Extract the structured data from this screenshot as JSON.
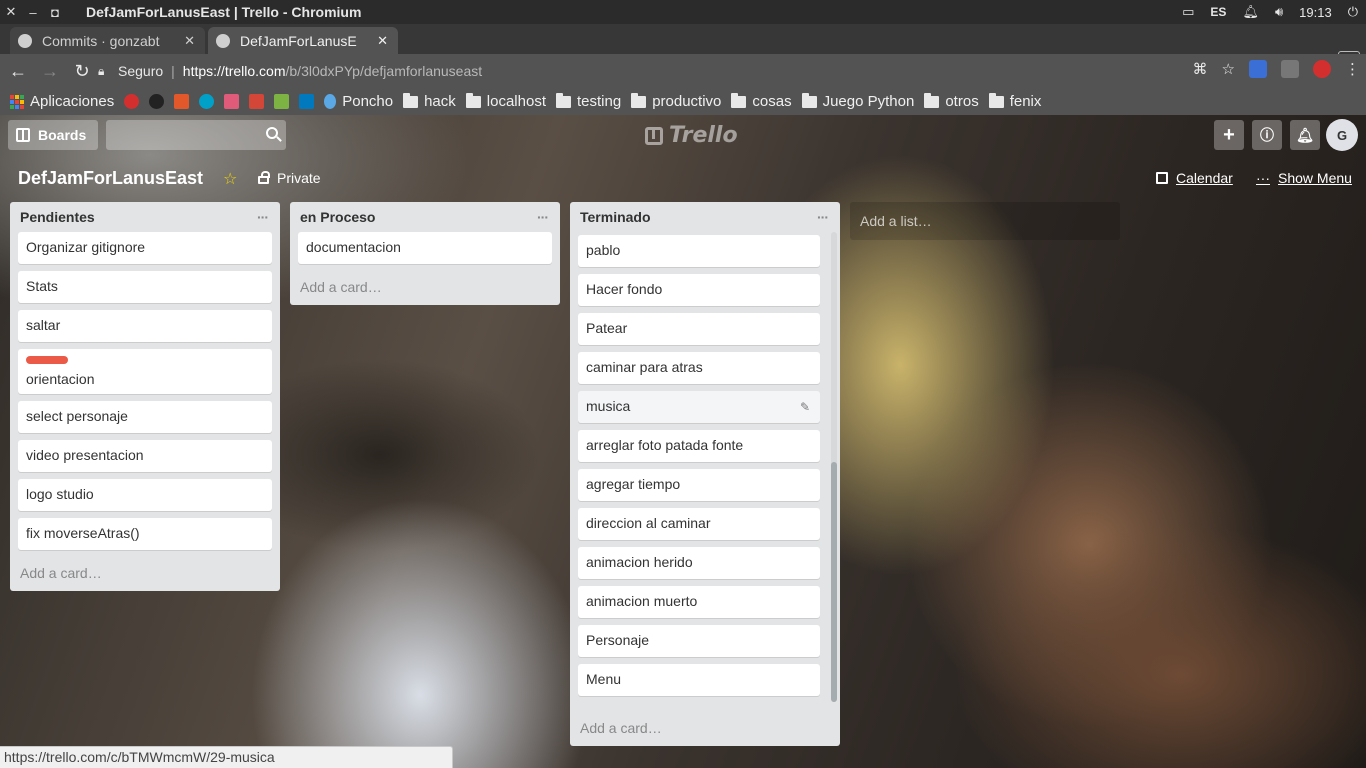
{
  "os": {
    "window_title": "DefJamForLanusEast | Trello - Chromium",
    "lang": "ES",
    "time": "19:13"
  },
  "browser": {
    "tabs": [
      {
        "label": "Commits · gonzabt",
        "active": false
      },
      {
        "label": "DefJamForLanusE",
        "active": true
      }
    ],
    "secure_label": "Seguro",
    "url_host": "https://trello.com",
    "url_path": "/b/3l0dxPYp/defjamforlanuseast",
    "bookmarks": {
      "apps": "Aplicaciones",
      "poncho": "Poncho",
      "folders": [
        "hack",
        "localhost",
        "testing",
        "productivo",
        "cosas",
        "Juego Python",
        "otros",
        "fenix"
      ]
    },
    "status_url": "https://trello.com/c/bTMWmcmW/29-musica"
  },
  "trello": {
    "boards_label": "Boards",
    "logo_text": "Trello",
    "avatar_initial": "G",
    "board_title": "DefJamForLanusEast",
    "visibility": "Private",
    "calendar_label": "Calendar",
    "show_menu_label": "Show Menu",
    "add_list": "Add a list…",
    "add_card": "Add a card…",
    "label_color": "#eb5a46",
    "lists": [
      {
        "name": "Pendientes",
        "cards": [
          "Organizar gitignore",
          "Stats",
          "saltar",
          "orientacion",
          "select personaje",
          "video presentacion",
          "logo studio",
          "fix moverseAtras()"
        ]
      },
      {
        "name": "en Proceso",
        "cards": [
          "documentacion"
        ]
      },
      {
        "name": "Terminado",
        "cards": [
          "pablo",
          "Hacer fondo",
          "Patear",
          "caminar para atras",
          "musica",
          "arreglar foto patada fonte",
          "agregar tiempo",
          "direccion al caminar",
          "animacion herido",
          "animacion muerto",
          "Personaje",
          "Menu"
        ]
      }
    ]
  }
}
